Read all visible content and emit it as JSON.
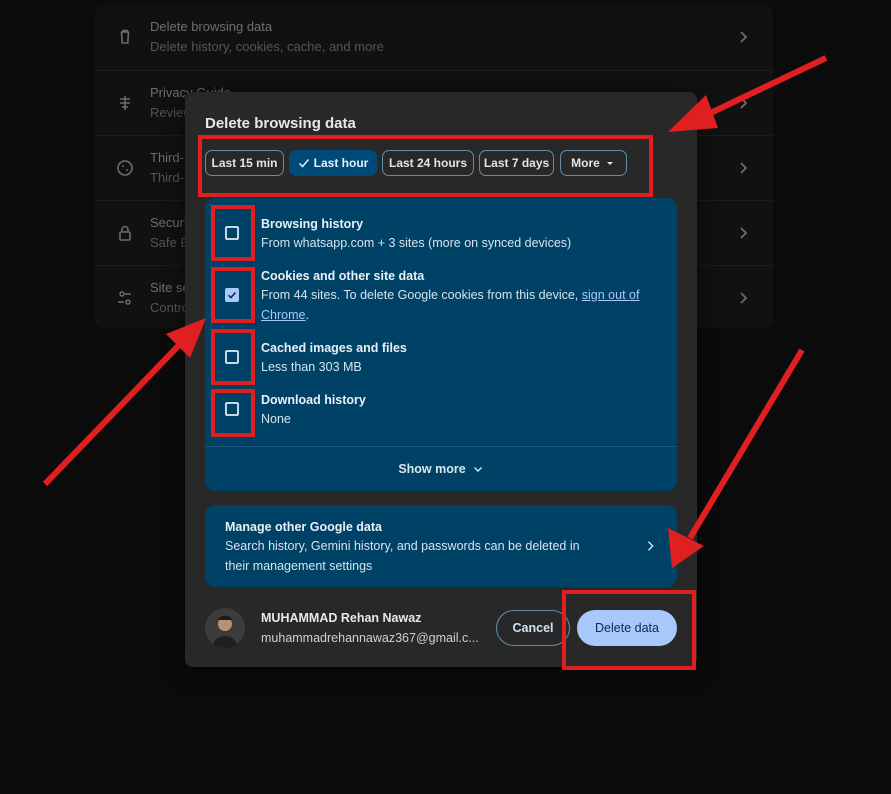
{
  "settings_list": {
    "rows": [
      {
        "title": "Delete browsing data",
        "subtitle": "Delete history, cookies, cache, and more",
        "icon": "trash-icon"
      },
      {
        "title": "Privacy Guide",
        "subtitle": "Review",
        "icon": "privacy-guide-icon"
      },
      {
        "title": "Third-",
        "subtitle": "Third-",
        "icon": "cookie-icon"
      },
      {
        "title": "Securi",
        "subtitle": "Safe B",
        "icon": "lock-icon"
      },
      {
        "title": "Site se",
        "subtitle": "Contro",
        "icon": "tune-icon"
      }
    ]
  },
  "dialog": {
    "title": "Delete browsing data",
    "time_range": {
      "options": [
        "Last 15 min",
        "Last hour",
        "Last 24 hours",
        "Last 7 days",
        "More"
      ],
      "selected": "Last hour"
    },
    "options": [
      {
        "title": "Browsing history",
        "subtitle": "From whatsapp.com + 3 sites (more on synced devices)",
        "checked": false
      },
      {
        "title": "Cookies and other site data",
        "subtitle_prefix": "From 44 sites. To delete Google cookies from this device,",
        "link_text": "sign out of",
        "link_text_2": "Chrome",
        "subtitle_suffix": ".",
        "checked": true
      },
      {
        "title": "Cached images and files",
        "subtitle": "Less than 303 MB",
        "checked": false
      },
      {
        "title": "Download history",
        "subtitle": "None",
        "checked": false
      }
    ],
    "show_more_label": "Show more",
    "manage_google": {
      "title": "Manage other Google data",
      "line1": "Search history, Gemini history, and passwords can be deleted in",
      "line2": "their management settings"
    },
    "account": {
      "name": "MUHAMMAD Rehan Nawaz",
      "email": "muhammadrehannawaz367@gmail.c..."
    },
    "cancel_label": "Cancel",
    "delete_label": "Delete data"
  },
  "colors": {
    "annotation_red": "#e02020",
    "accent": "#a8c7fa",
    "panel": "#004166"
  }
}
